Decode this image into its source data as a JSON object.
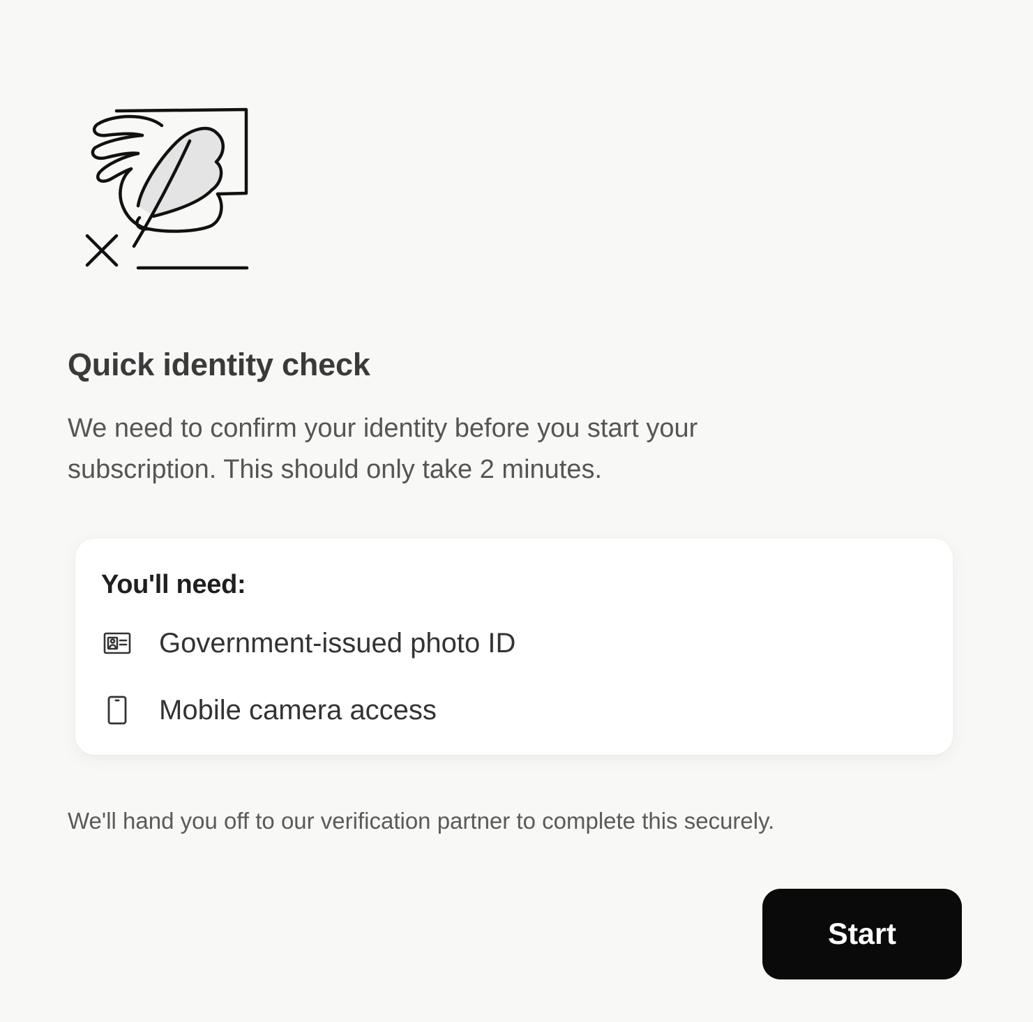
{
  "header": {
    "illustration_icon": "signature-quill-icon",
    "title": "Quick identity check",
    "description": "We need to confirm your identity before you start your subscription. This should only take 2 minutes."
  },
  "requirements": {
    "heading": "You'll need:",
    "items": [
      {
        "icon": "id-card-icon",
        "label": "Government-issued photo ID"
      },
      {
        "icon": "mobile-phone-icon",
        "label": "Mobile camera access"
      }
    ]
  },
  "footer": {
    "note": "We'll hand you off to our verification partner to complete this securely."
  },
  "actions": {
    "start_label": "Start"
  },
  "colors": {
    "background": "#f8f8f7",
    "card": "#ffffff",
    "button": "#0a0a0a",
    "button_text": "#ffffff"
  }
}
